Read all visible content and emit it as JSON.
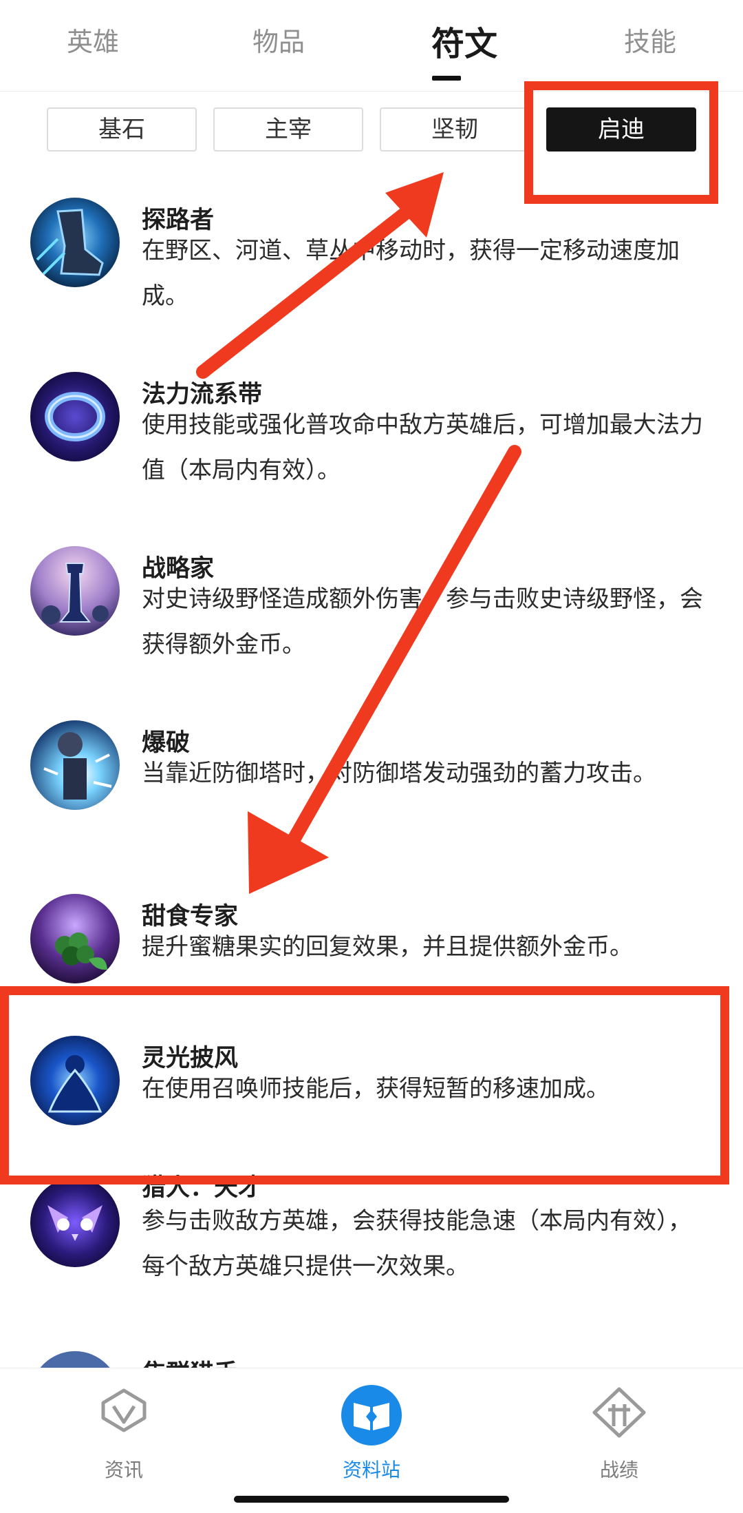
{
  "top_tabs": [
    {
      "label": "英雄",
      "active": false
    },
    {
      "label": "物品",
      "active": false
    },
    {
      "label": "符文",
      "active": true
    },
    {
      "label": "技能",
      "active": false
    }
  ],
  "sub_tabs": [
    {
      "label": "基石",
      "active": false
    },
    {
      "label": "主宰",
      "active": false
    },
    {
      "label": "坚韧",
      "active": false
    },
    {
      "label": "启迪",
      "active": true
    }
  ],
  "runes": [
    {
      "title": "探路者",
      "desc": "在野区、河道、草丛中移动时，获得一定移动速度加成。",
      "icon": "boot-icon"
    },
    {
      "title": "法力流系带",
      "desc": "使用技能或强化普攻命中敌方英雄后，可增加最大法力值（本局内有效）。",
      "icon": "ring-icon"
    },
    {
      "title": "战略家",
      "desc": "对史诗级野怪造成额外伤害。参与击败史诗级野怪，会获得额外金币。",
      "icon": "chess-rook-icon"
    },
    {
      "title": "爆破",
      "desc": "当靠近防御塔时，对防御塔发动强劲的蓄力攻击。",
      "icon": "tower-blast-icon"
    },
    {
      "title": "甜食专家",
      "desc": "提升蜜糖果实的回复效果，并且提供额外金币。",
      "icon": "honeyfruit-icon"
    },
    {
      "title": "灵光披风",
      "desc": "在使用召唤师技能后，获得短暂的移速加成。",
      "icon": "cloak-icon"
    },
    {
      "title": "猎人：天才",
      "desc": "参与击败敌方英雄，会获得技能急速（本局内有效），每个敌方英雄只提供一次效果。",
      "icon": "owl-icon"
    },
    {
      "title": "焦群猎手",
      "desc": "",
      "icon": "hunter-icon"
    }
  ],
  "bottom_nav": [
    {
      "label": "资讯",
      "icon": "news-icon",
      "active": false
    },
    {
      "label": "资料站",
      "icon": "book-icon",
      "active": true
    },
    {
      "label": "战绩",
      "icon": "record-icon",
      "active": false
    }
  ],
  "colors": {
    "annotation_red": "#f03a1f",
    "accent_blue": "#1a8ae8",
    "active_tab_bg": "#151515"
  }
}
